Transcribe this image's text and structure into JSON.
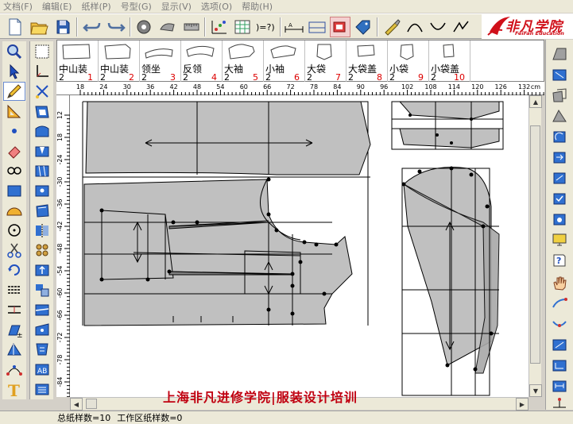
{
  "menu": [
    {
      "label": "文档(F)"
    },
    {
      "label": "编辑(E)"
    },
    {
      "label": "纸样(P)"
    },
    {
      "label": "号型(G)"
    },
    {
      "label": "显示(V)"
    },
    {
      "label": "选项(O)"
    },
    {
      "label": "帮助(H)"
    }
  ],
  "logo": {
    "brand": "非凡学院",
    "sub": "FeiFan Education"
  },
  "pieces": [
    {
      "name": "中山装",
      "count": "2",
      "index": "1"
    },
    {
      "name": "中山装",
      "count": "2",
      "index": "2"
    },
    {
      "name": "领坐",
      "count": "2",
      "index": "3"
    },
    {
      "name": "反领",
      "count": "2",
      "index": "4"
    },
    {
      "name": "大袖",
      "count": "2",
      "index": "5"
    },
    {
      "name": "小袖",
      "count": "2",
      "index": "6"
    },
    {
      "name": "大袋",
      "count": "2",
      "index": "7"
    },
    {
      "name": "大袋盖",
      "count": "2",
      "index": "8"
    },
    {
      "name": "小袋",
      "count": "2",
      "index": "9"
    },
    {
      "name": "小袋盖",
      "count": "2",
      "index": "10"
    }
  ],
  "ruler": {
    "unit": "cm",
    "top_ticks": [
      "18",
      "24",
      "30",
      "36",
      "42",
      "48",
      "54",
      "60",
      "66",
      "72",
      "78",
      "84",
      "90",
      "96",
      "102",
      "108",
      "114",
      "120",
      "126",
      "132"
    ],
    "left_ticks": [
      "12",
      "18",
      "-24",
      "-30",
      "-36",
      "-42",
      "-48",
      "-54",
      "-60",
      "-66",
      "-72",
      "-78",
      "-84",
      "-90"
    ]
  },
  "watermark": "上海非凡进修学院|服装设计培训",
  "status": {
    "total": "总纸样数=10",
    "work": "工作区纸样数=0"
  },
  "colors": {
    "piece_fill": "#c0c0c0",
    "accent_red": "#d0101a",
    "ui_bg": "#ece9d8"
  }
}
